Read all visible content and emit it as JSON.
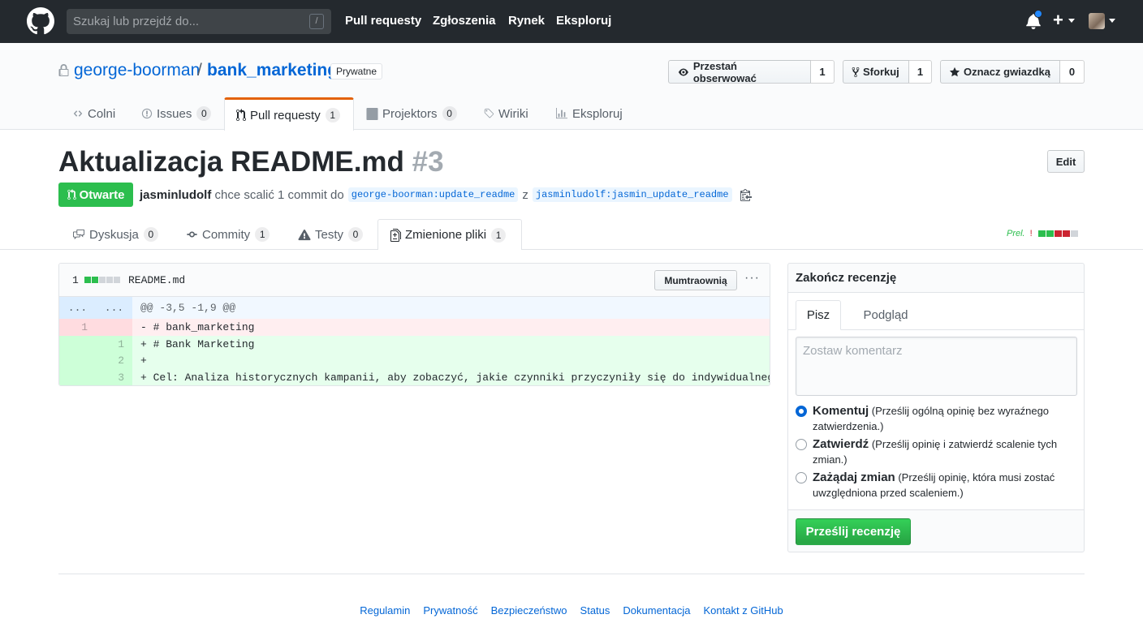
{
  "topnav": {
    "search_placeholder": "Szukaj lub przejdź do...",
    "slash_key": "/",
    "links": [
      "Pull requesty",
      "Zgłoszenia",
      "Rynek",
      "Eksploruj"
    ],
    "plus": "+"
  },
  "repo": {
    "owner": "george-boorman",
    "separator": "/",
    "name": "bank_marketing",
    "visibility": "Prywatne",
    "watch_label": "Przestań obserwować",
    "watch_count": "1",
    "fork_label": "Sforkuj",
    "fork_count": "1",
    "star_label": "Oznacz gwiazdką",
    "star_count": "0"
  },
  "repo_tabs": [
    {
      "label": "Colni",
      "count": ""
    },
    {
      "label": "Issues",
      "count": "0"
    },
    {
      "label": "Pull requesty",
      "count": "1"
    },
    {
      "label": "Projektors",
      "count": "0"
    },
    {
      "label": "Wiriki",
      "count": ""
    },
    {
      "label": "Eksploruj",
      "count": ""
    }
  ],
  "pr": {
    "title": "Aktualizacja README.md",
    "number": "#3",
    "edit_label": "Edit",
    "state": "Otwarte",
    "author": "jasminludolf",
    "action": "chce scalić 1 commit do",
    "base_branch": "george-boorman:update_readme",
    "from_word": "z",
    "head_branch": "jasminludolf:jasmin_update_readme"
  },
  "pr_tabs": [
    {
      "label": "Dyskusja",
      "count": "0"
    },
    {
      "label": "Commity",
      "count": "1"
    },
    {
      "label": "Testy",
      "count": "0"
    },
    {
      "label": "Zmienione pliki",
      "count": "1"
    }
  ],
  "diffstat": {
    "label": "Prel.",
    "mark": "!"
  },
  "file": {
    "count": "1",
    "name": "README.md",
    "view_button": "Mumtraownią",
    "menu": "···",
    "lines": [
      {
        "type": "hunk",
        "old": "...",
        "new": "...",
        "code": "@@ -3,5 -1,9 @@"
      },
      {
        "type": "del",
        "old": "1",
        "new": "",
        "code": "- # bank_marketing"
      },
      {
        "type": "add",
        "old": "",
        "new": "1",
        "code": "+ # Bank Marketing"
      },
      {
        "type": "add",
        "old": "",
        "new": "2",
        "code": "+"
      },
      {
        "type": "add",
        "old": "",
        "new": "3",
        "code": "+ Cel: Analiza historycznych kampanii, aby zobaczyć, jakie czynniki przyczyniły się do indywidualnego ma"
      }
    ]
  },
  "review": {
    "title": "Zakończ recenzję",
    "tab_write": "Pisz",
    "tab_preview": "Podgląd",
    "placeholder": "Zostaw komentarz",
    "options": [
      {
        "label": "Komentuj",
        "desc": "(Prześlij ogólną opinię bez wyraźnego zatwierdzenia.)",
        "checked": true
      },
      {
        "label": "Zatwierdź",
        "desc": "(Prześlij opinię i zatwierdź scalenie tych zmian.)",
        "checked": false
      },
      {
        "label": "Zażądaj zmian",
        "desc": "(Prześlij opinię, która musi zostać uwzględniona przed scaleniem.)",
        "checked": false
      }
    ],
    "submit_label": "Prześlij recenzję"
  },
  "footer": {
    "links": [
      "Regulamin",
      "Prywatność",
      "Bezpieczeństwo",
      "Status",
      "Dokumentacja",
      "Kontakt z GitHub"
    ]
  },
  "colors": {
    "topnav_bg": "#24292e",
    "link": "#0366d6",
    "open_green": "#2cbe4e",
    "tab_accent": "#e36209",
    "del_bg": "#ffeef0",
    "add_bg": "#e6ffed"
  }
}
